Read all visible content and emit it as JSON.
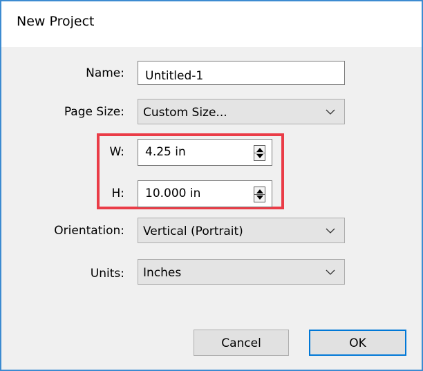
{
  "dialog": {
    "title": "New Project"
  },
  "fields": {
    "name": {
      "label": "Name:",
      "value": "Untitled-1"
    },
    "page_size": {
      "label": "Page Size:",
      "value": "Custom Size..."
    },
    "width": {
      "label": "W:",
      "value": "4.25 in"
    },
    "height": {
      "label": "H:",
      "value": "10.000 in"
    },
    "orientation": {
      "label": "Orientation:",
      "value": "Vertical (Portrait)"
    },
    "units": {
      "label": "Units:",
      "value": "Inches"
    }
  },
  "buttons": {
    "cancel": "Cancel",
    "ok": "OK"
  },
  "colors": {
    "highlight": "#ea3c47",
    "window_border": "#3c8bd1",
    "default_button_border": "#0078d7"
  },
  "icons": {
    "dropdown": "chevron-down-icon",
    "spinner": "spin-arrows-icon"
  }
}
